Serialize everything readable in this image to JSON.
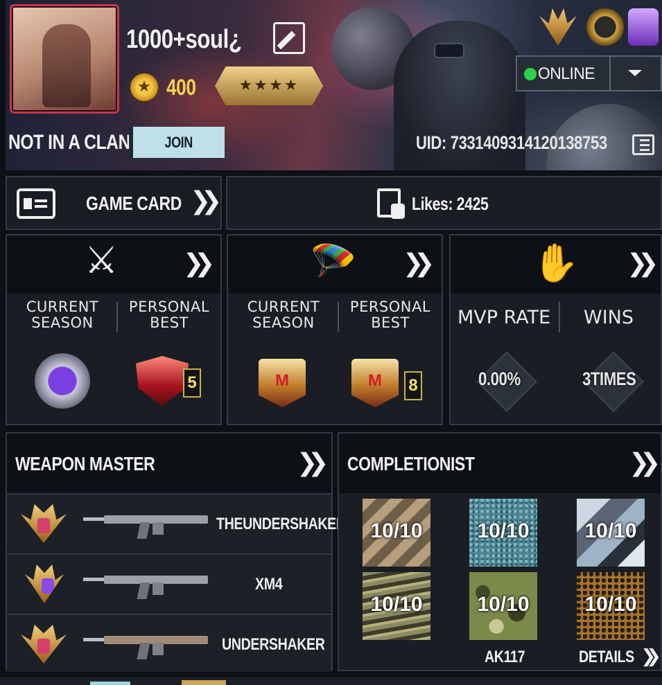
{
  "header": {
    "player_name": "1000+soul¿",
    "coins": "400",
    "rank_stars": "★★★★",
    "clan_status": "NOT IN A CLAN",
    "join_label": "JOIN",
    "uid": "UID: 7331409314120138753",
    "status": "ONLINE"
  },
  "game_card": {
    "label": "GAME CARD",
    "chevron": "❯❯"
  },
  "likes": {
    "text": "Likes:  2425"
  },
  "multiplayer_card": {
    "col1": "CURRENT\nSEASON",
    "col2": "PERSONAL\nBEST",
    "best_tier": "5"
  },
  "battle_royale_card": {
    "col1": "CURRENT\nSEASON",
    "col2": "PERSONAL\nBEST",
    "best_tier": "8"
  },
  "zombie_card": {
    "mvp_label": "MVP RATE",
    "wins_label": "WINS",
    "mvp_value": "0.00%",
    "wins_value": "3TIMES"
  },
  "weapon_master": {
    "title": "WEAPON MASTER",
    "weapons": [
      {
        "name": "THEUNDERSHAKER"
      },
      {
        "name": "XM4"
      },
      {
        "name": "UNDERSHAKER"
      }
    ]
  },
  "completionist": {
    "title": "COMPLETIONIST",
    "camos": [
      "10/10",
      "10/10",
      "10/10",
      "10/10",
      "10/10",
      "10/10"
    ],
    "weapon": "AK117",
    "details_label": "DETAILS"
  },
  "colors": {
    "online_dot": "#29d34a",
    "coin_text": "#f5d24e",
    "join_bg": "#bfe0e8",
    "tier_text": "#f2e06a"
  }
}
